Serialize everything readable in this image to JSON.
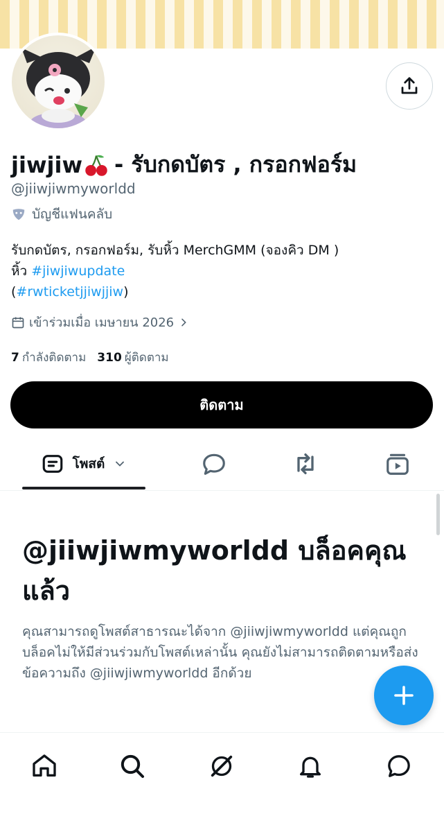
{
  "colors": {
    "accent": "#1d9bf0",
    "text": "#0f1419",
    "secondary": "#536471",
    "button": "#000000"
  },
  "profile": {
    "display_name": "jiwjiw",
    "name_emoji": "cherries",
    "name_suffix": "- รับกดบัตร , กรอกฟอร์ม",
    "handle": "@jiiwjiwmyworldd",
    "affiliation": "บัญชีแฟนคลับ",
    "bio_line1": "รับกดบัตร, กรอกฟอร์ม, รับหิ้ว MerchGMM (จองคิว DM )",
    "bio_line2_prefix": "หิ้ว ",
    "bio_hashtag1": "#jiwjiwupdate",
    "bio_line3_open": "(",
    "bio_hashtag2": "#rwticketjjiwjjiw",
    "bio_line3_close": ")",
    "joined": "เข้าร่วมเมื่อ เมษายน 2026",
    "following_count": "7",
    "following_label": "กำลังติดตาม",
    "followers_count": "310",
    "followers_label": "ผู้ติดตาม",
    "follow_button": "ติดตาม"
  },
  "tabs": {
    "posts_label": "โพสต์"
  },
  "blocked": {
    "title_handle": "@jiiwjiwmyworldd",
    "title_suffix": " บล็อคคุณแล้ว",
    "message": "คุณสามารถดูโพสต์สาธารณะได้จาก @jiiwjiwmyworldd แต่คุณถูกบล็อคไม่ให้มีส่วนร่วมกับโพสต์เหล่านั้น คุณยังไม่สามารถติดตามหรือส่งข้อความถึง @jiiwjiwmyworldd อีกด้วย"
  },
  "icons": {
    "share": "share-icon",
    "fan": "mask-icon",
    "calendar": "calendar-icon",
    "posts": "posts-icon",
    "replies": "replies-icon",
    "reposts": "repost-icon",
    "media": "media-icon",
    "compose": "plus-icon",
    "home": "home-icon",
    "search": "search-icon",
    "grok": "grok-icon",
    "notifications": "bell-icon",
    "messages": "messages-icon"
  }
}
